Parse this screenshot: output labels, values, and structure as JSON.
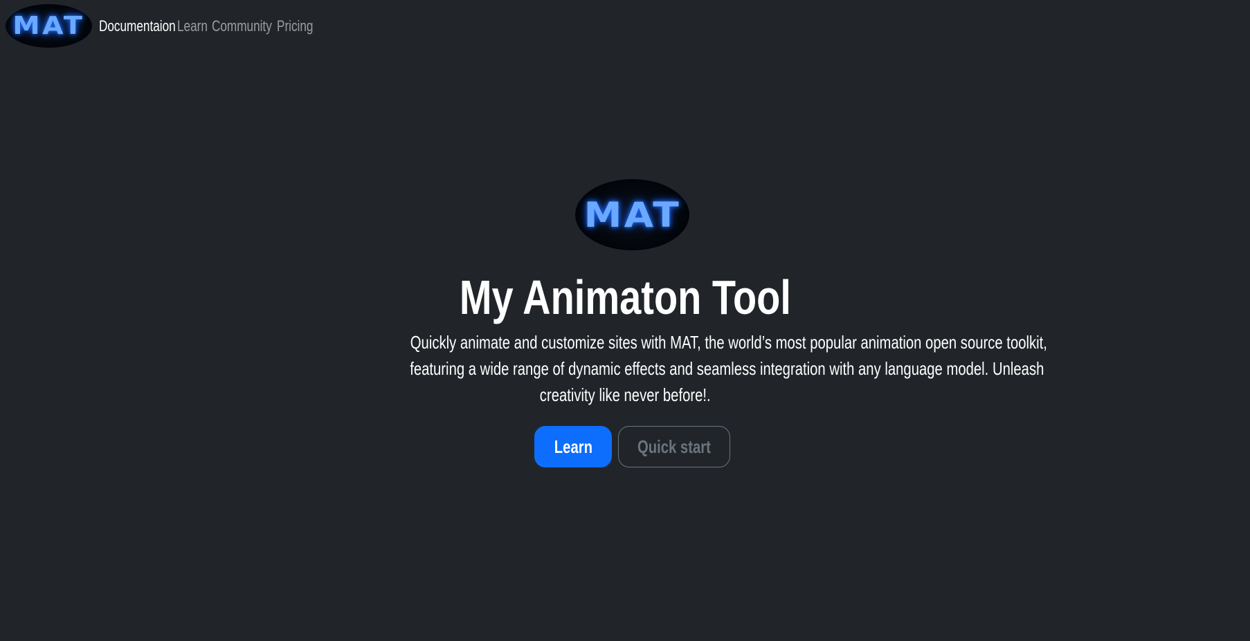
{
  "brand": {
    "logo_text": "MAT",
    "logo_icon": "mat-logo",
    "accent_color": "#0d6efd",
    "logo_glow_color": "#6aa9ff"
  },
  "nav": {
    "items": [
      {
        "label": "Documentaion",
        "active": true
      },
      {
        "label": "Learn",
        "active": false
      },
      {
        "label": "Community",
        "active": false
      },
      {
        "label": "Pricing",
        "active": false
      }
    ]
  },
  "hero": {
    "title": "My Animaton Tool",
    "description_lines": [
      "Quickly animate and customize sites with MAT, the world’s most popular animation open source toolkit,",
      "featuring a wide range of dynamic effects and seamless integration with any language model. Unleash",
      "creativity like never before!."
    ],
    "primary_button": "Learn",
    "secondary_button": "Quick start"
  },
  "colors": {
    "background": "#212529",
    "primary_button": "#0d6efd",
    "secondary_border": "#6c757d",
    "nav_inactive": "rgba(255,255,255,0.55)"
  }
}
